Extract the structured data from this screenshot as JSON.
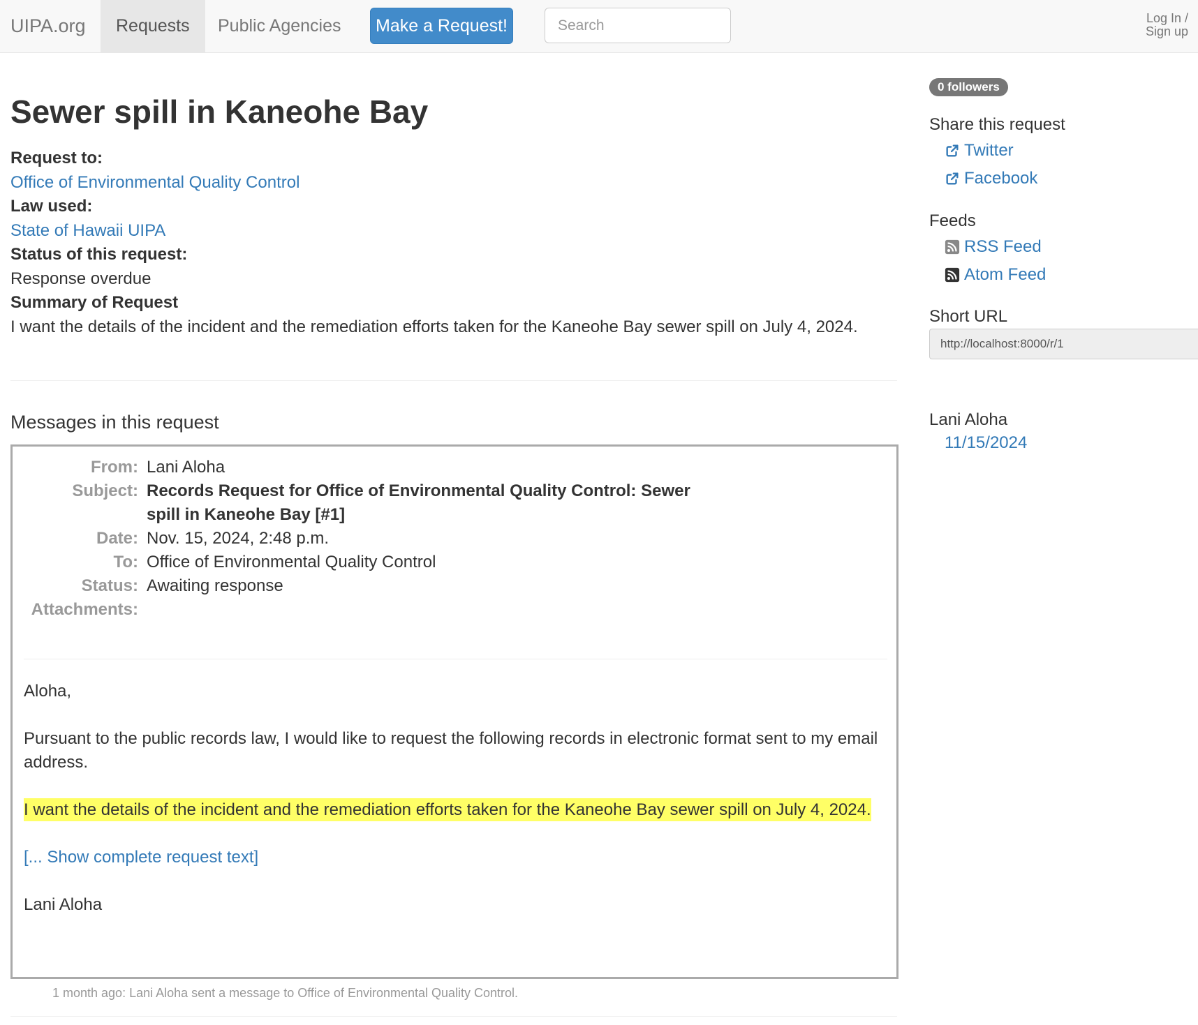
{
  "nav": {
    "brand": "UIPA.org",
    "requests": "Requests",
    "public_agencies": "Public Agencies",
    "make_request": "Make a Request!",
    "search_placeholder": "Search",
    "login_line1": "Log In /",
    "login_line2": "Sign up"
  },
  "request": {
    "title": "Sewer spill in Kaneohe Bay",
    "request_to_label": "Request to:",
    "request_to": "Office of Environmental Quality Control",
    "law_label": "Law used:",
    "law": "State of Hawaii UIPA",
    "status_label": "Status of this request:",
    "status": "Response overdue",
    "summary_label": "Summary of Request",
    "summary": "I want the details of the incident and the remediation efforts taken for the Kaneohe Bay sewer spill on July 4, 2024."
  },
  "messages": {
    "heading": "Messages in this request",
    "message": {
      "from_label": "From:",
      "from": "Lani Aloha",
      "subject_label": "Subject:",
      "subject": "Records Request for Office of Environmental Quality Control: Sewer spill in Kaneohe Bay [#1]",
      "date_label": "Date:",
      "date": "Nov. 15, 2024, 2:48 p.m.",
      "to_label": "To:",
      "to": "Office of Environmental Quality Control",
      "status_label": "Status:",
      "status": "Awaiting response",
      "attachments_label": "Attachments:",
      "greeting": "Aloha,",
      "paragraph": "Pursuant to the public records law, I would like to request the following records in electronic format sent to my email address.",
      "highlight": "I want the details of the incident and the remediation efforts taken for the Kaneohe Bay sewer spill on July 4, 2024.",
      "show_more": "[... Show complete request text]",
      "signature": "Lani Aloha"
    },
    "footer_note": "1 month ago: Lani Aloha sent a message to Office of Environmental Quality Control."
  },
  "sidebar": {
    "followers": "0 followers",
    "share_heading": "Share this request",
    "twitter": "Twitter",
    "facebook": "Facebook",
    "feeds_heading": "Feeds",
    "rss": "RSS Feed",
    "atom": "Atom Feed",
    "short_url_heading": "Short URL",
    "short_url": "http://localhost:8000/r/1",
    "requester": "Lani Aloha",
    "requester_date": "11/15/2024"
  },
  "icons": {
    "share": "share-icon",
    "feed": "rss-feed-icon"
  },
  "colors": {
    "link": "#337ab7",
    "primary_button": "#428bca",
    "highlight": "#ffff66",
    "badge": "#777777"
  }
}
